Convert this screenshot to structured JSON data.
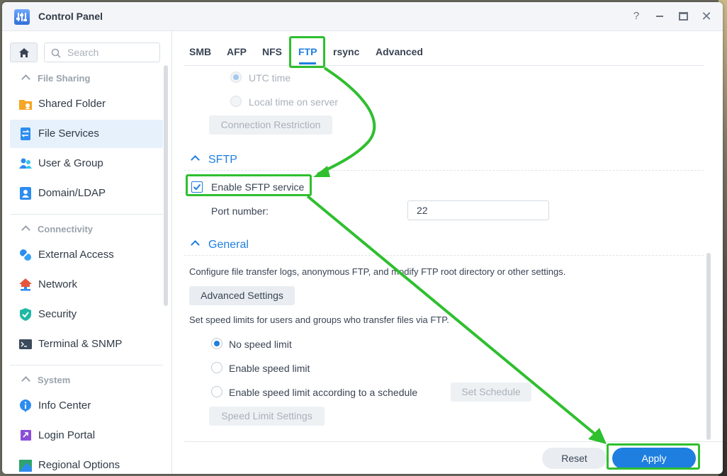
{
  "window": {
    "title": "Control Panel",
    "help_glyph": "?",
    "close_glyph": "✕"
  },
  "sidebar": {
    "search_placeholder": "Search",
    "groups": [
      {
        "label": "File Sharing"
      },
      {
        "label": "Connectivity"
      },
      {
        "label": "System"
      }
    ],
    "items": [
      {
        "label": "Shared Folder",
        "icon": "folder-icon",
        "active": false
      },
      {
        "label": "File Services",
        "icon": "file-services-icon",
        "active": true
      },
      {
        "label": "User & Group",
        "icon": "users-icon",
        "active": false
      },
      {
        "label": "Domain/LDAP",
        "icon": "domain-icon",
        "active": false
      },
      {
        "label": "External Access",
        "icon": "external-access-icon",
        "active": false
      },
      {
        "label": "Network",
        "icon": "network-icon",
        "active": false
      },
      {
        "label": "Security",
        "icon": "shield-icon",
        "active": false
      },
      {
        "label": "Terminal & SNMP",
        "icon": "terminal-icon",
        "active": false
      },
      {
        "label": "Info Center",
        "icon": "info-icon",
        "active": false
      },
      {
        "label": "Login Portal",
        "icon": "login-portal-icon",
        "active": false
      },
      {
        "label": "Regional Options",
        "icon": "regional-options-icon",
        "active": false
      }
    ]
  },
  "tabs": [
    {
      "label": "SMB",
      "active": false
    },
    {
      "label": "AFP",
      "active": false
    },
    {
      "label": "NFS",
      "active": false
    },
    {
      "label": "FTP",
      "active": true
    },
    {
      "label": "rsync",
      "active": false
    },
    {
      "label": "Advanced",
      "active": false
    }
  ],
  "ftp": {
    "time_options": [
      {
        "label": "UTC time",
        "selected": true,
        "disabled": true
      },
      {
        "label": "Local time on server",
        "selected": false,
        "disabled": true
      }
    ],
    "connection_restriction_label": "Connection Restriction",
    "sftp": {
      "title": "SFTP",
      "enable_label": "Enable SFTP service",
      "enabled": true,
      "port_label": "Port number:",
      "port_value": "22"
    },
    "general": {
      "title": "General",
      "description": "Configure file transfer logs, anonymous FTP, and modify FTP root directory or other settings.",
      "advanced_settings_label": "Advanced Settings",
      "speed_description": "Set speed limits for users and groups who transfer files via FTP.",
      "speed_options": [
        {
          "label": "No speed limit",
          "selected": true
        },
        {
          "label": "Enable speed limit",
          "selected": false
        },
        {
          "label": "Enable speed limit according to a schedule",
          "selected": false
        }
      ],
      "set_schedule_label": "Set Schedule",
      "speed_limit_settings_label": "Speed Limit Settings"
    }
  },
  "footer": {
    "reset_label": "Reset",
    "apply_label": "Apply"
  },
  "colors": {
    "accent": "#1e7fe0",
    "highlight": "#2fbf2f",
    "active_nav": "#e6f1fc"
  }
}
